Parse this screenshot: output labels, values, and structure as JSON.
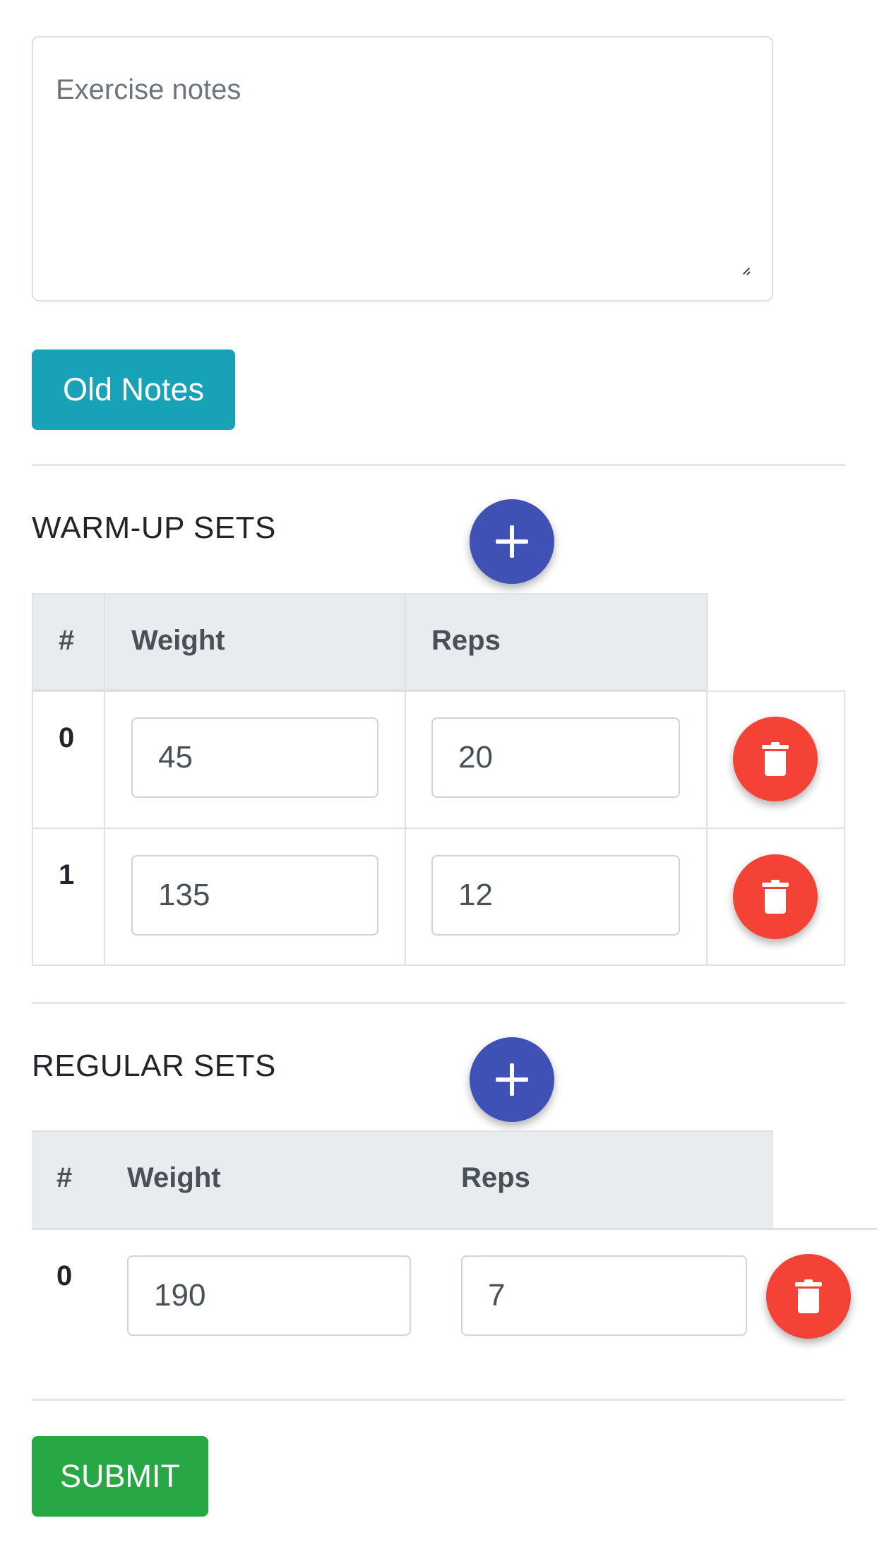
{
  "notes": {
    "placeholder": "Exercise notes"
  },
  "old_notes_button": "Old Notes",
  "warmup": {
    "title": "WARM-UP SETS",
    "headers": [
      "#",
      "Weight",
      "Reps"
    ],
    "rows": [
      {
        "index": "0",
        "weight": "45",
        "reps": "20"
      },
      {
        "index": "1",
        "weight": "135",
        "reps": "12"
      }
    ]
  },
  "regular": {
    "title": "REGULAR SETS",
    "headers": [
      "#",
      "Weight",
      "Reps"
    ],
    "rows": [
      {
        "index": "0",
        "weight": "190",
        "reps": "7"
      }
    ]
  },
  "submit_button": "SUBMIT",
  "icons": {
    "add": "plus-icon",
    "delete": "trash-icon"
  },
  "colors": {
    "info": "#17a2b8",
    "primary_fab": "#3f51b5",
    "danger_fab": "#f44336",
    "success": "#28a745"
  }
}
